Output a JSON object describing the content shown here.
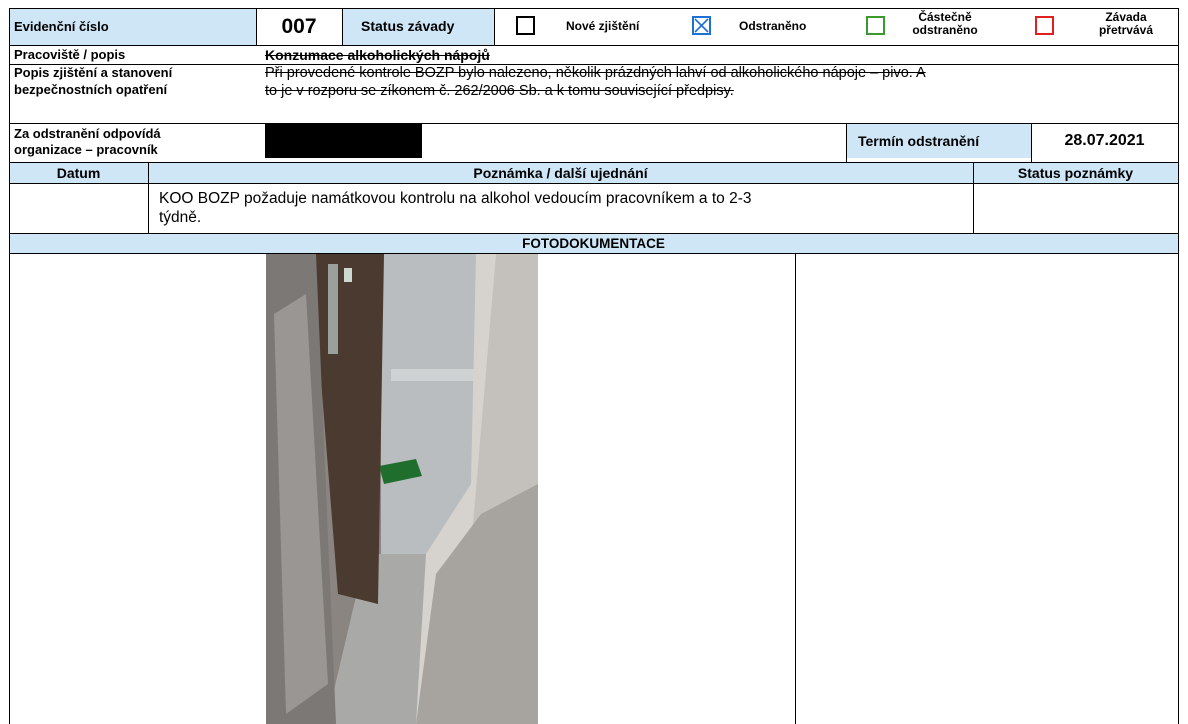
{
  "header": {
    "evidence_label": "Evidenční číslo",
    "evidence_number": "007",
    "status_label": "Status závady",
    "options": [
      {
        "label": "Nové zjištění",
        "checked": false,
        "color": "#000000"
      },
      {
        "label": "Odstraněno",
        "checked": true,
        "color": "#1f6fd6"
      },
      {
        "label": "Částečně odstraněno",
        "checked": false,
        "color": "#3a9a2e"
      },
      {
        "label": "Závada přetrvává",
        "checked": false,
        "color": "#e02020"
      }
    ],
    "header_bg": "#cfe6f7"
  },
  "workplace": {
    "label": "Pracoviště / popis",
    "value": "Konzumace alkoholických nápojů"
  },
  "finding": {
    "label_line1": "Popis zjištění a stanovení",
    "label_line2": "bezpečnostních opatření",
    "line1": "Při provedené kontrole BOZP bylo nalezeno, několik prázdných lahví od alkoholického nápoje – pivo. A",
    "line2": "to je v rozporu se zíkonem č. 262/2006 Sb. a k tomu související předpisy."
  },
  "responsible": {
    "label_line1": "Za odstranění odpovídá",
    "label_line2": "organizace – pracovník",
    "deadline_label": "Termín odstranění",
    "deadline_value": "28.07.2021"
  },
  "notes": {
    "col_date": "Datum",
    "col_note": "Poznámka / další ujednání",
    "col_status": "Status poznámky",
    "row_date": "",
    "row_text_line1": "KOO BOZP požaduje namátkovou kontrolu na alkohol vedoucím pracovníkem a to 2-3",
    "row_text_line2": "týdně.",
    "row_status": ""
  },
  "photo": {
    "section_label": "FOTODOKUMENTACE"
  }
}
